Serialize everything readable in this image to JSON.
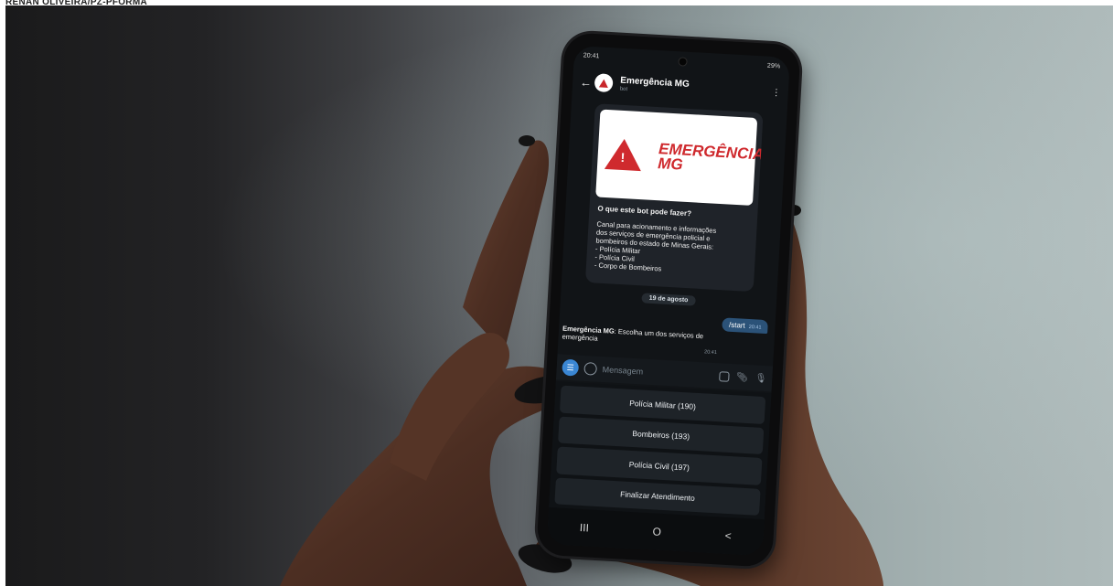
{
  "credit": "RENAN OLIVEIRA/PZ-PFORMA",
  "phone": {
    "status_bar": {
      "time": "20:41",
      "right": "29%"
    },
    "header": {
      "back_icon": "arrow-left-icon",
      "title": "Emergência MG",
      "subtitle": "bot",
      "menu_icon": "more-vert-icon"
    },
    "banner": {
      "wordmark_line1": "EMERGÊNCIA",
      "wordmark_line2": "MG",
      "brand_color": "#cf2a2e"
    },
    "intro": {
      "heading": "O que este bot pode fazer?",
      "lines": [
        "Canal para acionamento e informações",
        "dos serviços de emergência policial e",
        "bombeiros do estado de Minas Gerais:",
        "- Polícia Militar",
        "- Polícia Civil",
        "- Corpo de Bombeiros"
      ]
    },
    "date_separator": "19 de agosto",
    "outgoing": {
      "text": "/start",
      "time": "20:41"
    },
    "incoming": {
      "sender": "Emergência MG",
      "text": ": Escolha um dos serviços de emergência",
      "time": "20:41"
    },
    "composer": {
      "placeholder": "Mensagem"
    },
    "keyboard": [
      "Polícia Militar (190)",
      "Bombeiros (193)",
      "Polícia Civil (197)",
      "Finalizar Atendimento"
    ],
    "nav": {
      "recents": "III",
      "home": "O",
      "back": "<"
    }
  }
}
